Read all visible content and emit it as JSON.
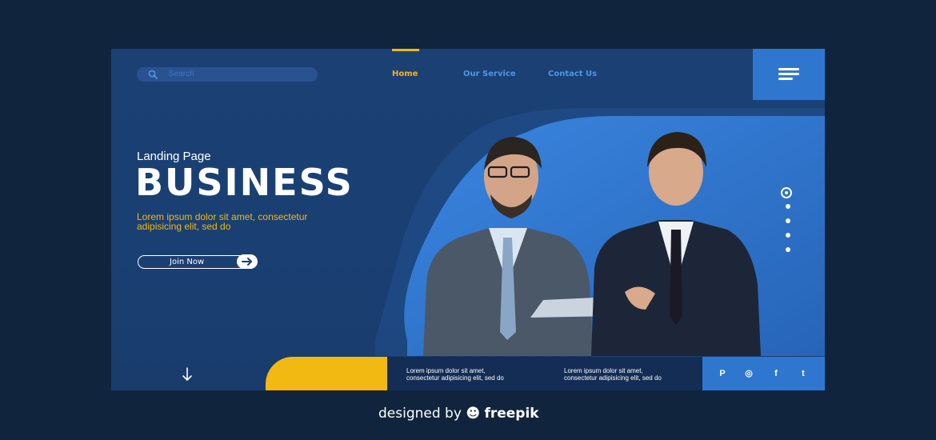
{
  "search": {
    "placeholder": "Search"
  },
  "nav": {
    "items": [
      {
        "label": "Home",
        "active": true
      },
      {
        "label": "Our Service",
        "active": false
      },
      {
        "label": "Contact Us",
        "active": false
      }
    ]
  },
  "hero": {
    "kicker": "Landing Page",
    "title": "BUSINESS",
    "lorem_line1": "Lorem ipsum dolor sit amet, consectetur",
    "lorem_line2": "adipisicing elit, sed do",
    "cta_label": "Join Now"
  },
  "footer": {
    "block1_line1": "Lorem ipsum dolor sit amet,",
    "block1_line2": "consectetur adipisicing elit, sed do",
    "block2_line1": "Lorem ipsum dolor sit amet,",
    "block2_line2": "consectetur adipisicing elit, sed do",
    "social_icons": [
      "pinterest-icon",
      "instagram-icon",
      "facebook-icon",
      "twitter-icon"
    ],
    "social_glyphs": [
      "P",
      "◎",
      "f",
      "t"
    ]
  },
  "credit": {
    "prefix": "designed by",
    "brand": "freepik"
  },
  "colors": {
    "accent": "#f2b912",
    "primary": "#2f77ce",
    "background": "#1b4174",
    "page": "#10253d"
  }
}
